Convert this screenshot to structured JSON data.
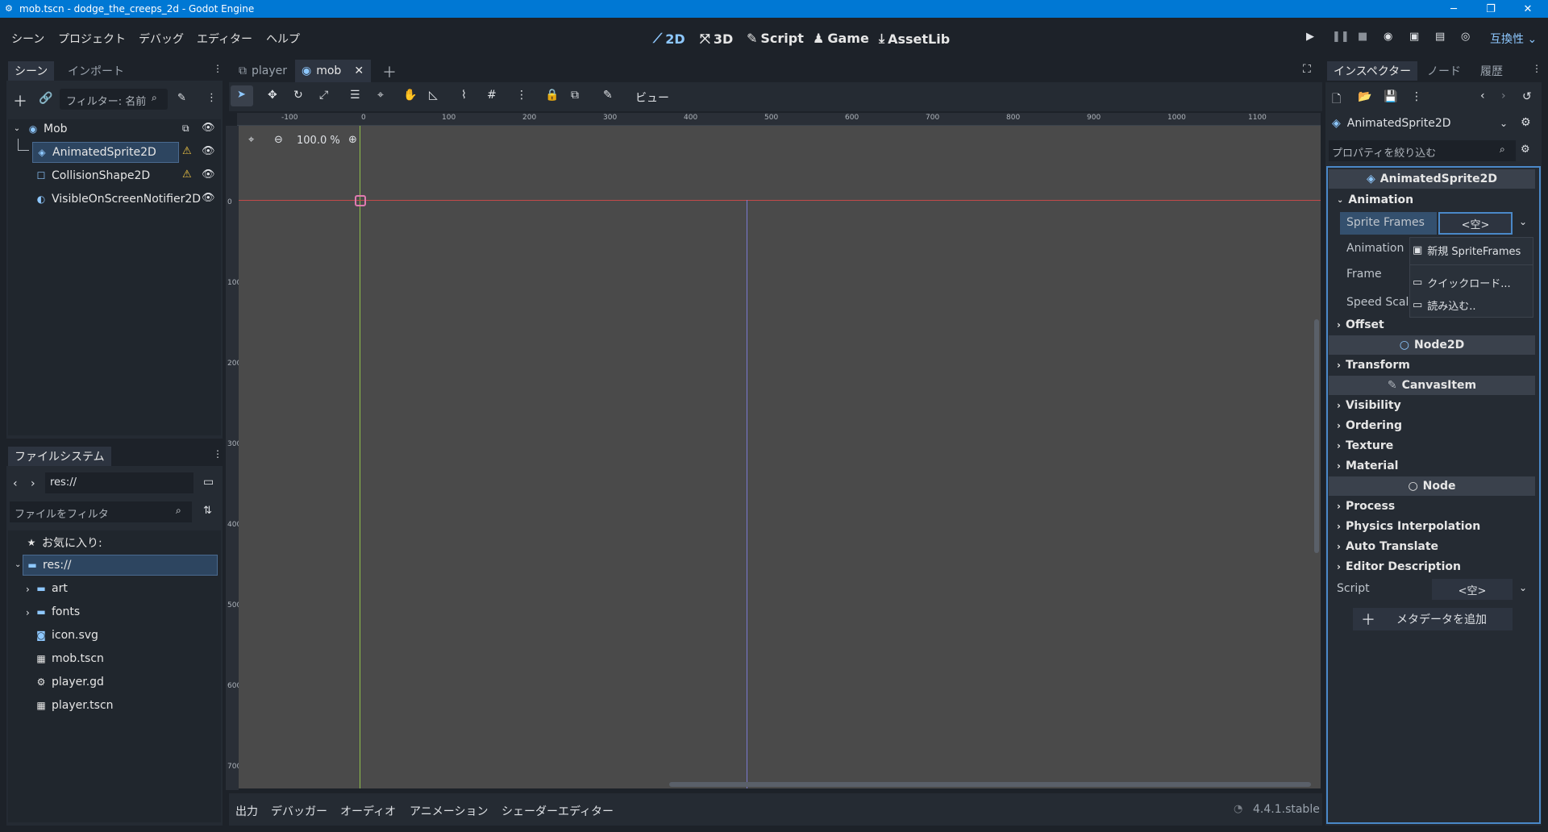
{
  "window": {
    "title": "mob.tscn - dodge_the_creeps_2d - Godot Engine",
    "min": "─",
    "restore": "❐",
    "close": "✕"
  },
  "menu": [
    "シーン",
    "プロジェクト",
    "デバッグ",
    "エディター",
    "ヘルプ"
  ],
  "workspaces": [
    {
      "label": "2D",
      "icon": "2d-icon"
    },
    {
      "label": "3D",
      "icon": "3d-icon"
    },
    {
      "label": "Script",
      "icon": "script-icon"
    },
    {
      "label": "Game",
      "icon": "game-icon"
    },
    {
      "label": "AssetLib",
      "icon": "assetlib-icon"
    }
  ],
  "compat": "互換性",
  "scene_dock": {
    "tabs": [
      "シーン",
      "インポート"
    ],
    "filter_placeholder": "フィルター: 名前",
    "nodes": [
      {
        "label": "Mob"
      },
      {
        "label": "AnimatedSprite2D"
      },
      {
        "label": "CollisionShape2D"
      },
      {
        "label": "VisibleOnScreenNotifier2D"
      }
    ]
  },
  "filesystem": {
    "tab": "ファイルシステム",
    "path": "res://",
    "filter_placeholder": "ファイルをフィルタ",
    "favorites": "お気に入り:",
    "items": [
      "res://",
      "art",
      "fonts",
      "icon.svg",
      "mob.tscn",
      "player.gd",
      "player.tscn"
    ]
  },
  "editor_tabs": [
    "player",
    "mob"
  ],
  "toolbar": {
    "view": "ビュー"
  },
  "zoom": "100.0 %",
  "ruler_h": [
    "-100",
    "0",
    "100",
    "200",
    "300",
    "400",
    "500",
    "600",
    "700",
    "800",
    "900",
    "1000",
    "1100"
  ],
  "ruler_v": [
    "0",
    "100",
    "200",
    "300",
    "400",
    "500",
    "600",
    "700"
  ],
  "bottom_tabs": [
    "出力",
    "デバッガー",
    "オーディオ",
    "アニメーション",
    "シェーダーエディター"
  ],
  "version": "4.4.1.stable",
  "inspector": {
    "tabs": [
      "インスペクター",
      "ノード",
      "履歴"
    ],
    "object": "AnimatedSprite2D",
    "filter_placeholder": "プロパティを絞り込む",
    "class_header": "AnimatedSprite2D",
    "groups": {
      "animation": "Animation",
      "offset": "Offset",
      "node2d": "Node2D",
      "transform": "Transform",
      "canvasitem": "CanvasItem",
      "visibility": "Visibility",
      "ordering": "Ordering",
      "texture": "Texture",
      "material": "Material",
      "node": "Node",
      "process": "Process",
      "physics": "Physics Interpolation",
      "autotranslate": "Auto Translate",
      "editordesc": "Editor Description"
    },
    "props": {
      "sprite_frames": "Sprite Frames",
      "sprite_frames_value": "<空>",
      "animation": "Animation",
      "frame": "Frame",
      "speed_scale": "Speed Scale",
      "script": "Script",
      "script_value": "<空>"
    },
    "add_meta": "メタデータを追加",
    "popup": [
      "新規 SpriteFrames",
      "クイックロード...",
      "読み込む.."
    ]
  }
}
